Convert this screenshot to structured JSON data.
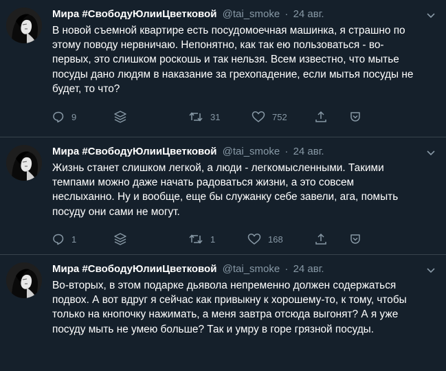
{
  "tweets": [
    {
      "name": "Мира #СвободуЮлииЦветковой",
      "handle": "@tai_smoke",
      "dot": "·",
      "date": "24 авг.",
      "lines": [
        "В новой съемной квартире есть посудомоечная машинка, я страшно по",
        "этому поводу нервничаю. Непонятно, как так ею пользоваться - во-",
        "первых, это слишком роскошь и так нельзя. Всем известно, что мытье",
        "посуды дано людям в наказание за грехопадение, если мытья посуды не",
        "будет, то что?"
      ],
      "replies": "9",
      "retweets": "31",
      "likes": "752"
    },
    {
      "name": "Мира #СвободуЮлииЦветковой",
      "handle": "@tai_smoke",
      "dot": "·",
      "date": "24 авг.",
      "lines": [
        "Жизнь станет слишком легкой, а люди - легкомысленными. Такими",
        "темпами можно даже начать радоваться жизни, а это совсем",
        "неслыханно. Ну и вообще, еще бы служанку себе завели, ага, помыть",
        "посуду они сами не могут."
      ],
      "replies": "1",
      "retweets": "1",
      "likes": "168"
    },
    {
      "name": "Мира #СвободуЮлииЦветковой",
      "handle": "@tai_smoke",
      "dot": "·",
      "date": "24 авг.",
      "lines": [
        "Во-вторых, в этом подарке дьявола непременно должен содержаться",
        "подвох. А вот вдруг я сейчас как привыкну к хорошему-то, к тому, чтобы",
        "только на кнопочку нажимать, а меня завтра отсюда выгонят? А я уже",
        "посуду мыть не умею больше? Так и умру в горе грязной посуды."
      ]
    }
  ],
  "icons": {
    "reply": "reply-icon",
    "stack": "layers-icon",
    "retweet": "retweet-icon",
    "like": "heart-icon",
    "share": "share-icon",
    "bookmark": "bookmark-icon",
    "more": "chevron-down-icon"
  },
  "colors": {
    "background": "#15202b",
    "text": "#ffffff",
    "muted": "#8899a6",
    "divider": "#38444d"
  }
}
